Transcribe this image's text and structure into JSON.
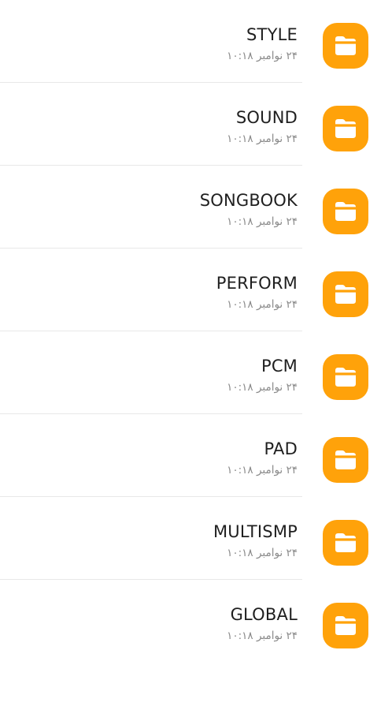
{
  "folders": [
    {
      "name": "STYLE",
      "date": "۲۴ نوامبر ۱۰:۱۸",
      "icon": "folder-icon"
    },
    {
      "name": "SOUND",
      "date": "۲۴ نوامبر ۱۰:۱۸",
      "icon": "folder-icon"
    },
    {
      "name": "SONGBOOK",
      "date": "۲۴ نوامبر ۱۰:۱۸",
      "icon": "folder-icon"
    },
    {
      "name": "PERFORM",
      "date": "۲۴ نوامبر ۱۰:۱۸",
      "icon": "folder-icon"
    },
    {
      "name": "PCM",
      "date": "۲۴ نوامبر ۱۰:۱۸",
      "icon": "folder-icon"
    },
    {
      "name": "PAD",
      "date": "۲۴ نوامبر ۱۰:۱۸",
      "icon": "folder-icon"
    },
    {
      "name": "MULTISMP",
      "date": "۲۴ نوامبر ۱۰:۱۸",
      "icon": "folder-icon"
    },
    {
      "name": "GLOBAL",
      "date": "۲۴ نوامبر ۱۰:۱۸",
      "icon": "folder-icon"
    }
  ],
  "colors": {
    "folder_accent": "#ffa20a",
    "folder_glyph": "#ffffff",
    "name_text": "#1f1f1f",
    "date_text": "#8a8a8a",
    "divider": "#e8e8e8",
    "background": "#ffffff"
  }
}
